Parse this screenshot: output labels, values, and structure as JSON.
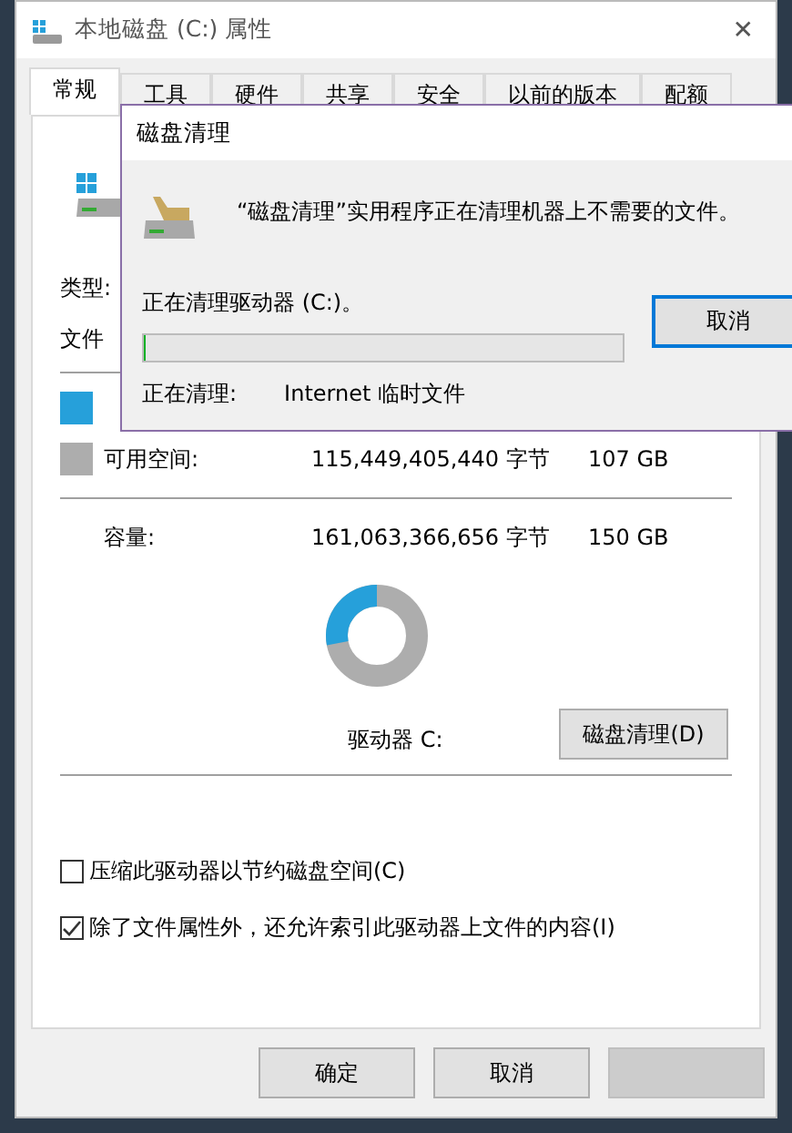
{
  "window": {
    "title": "本地磁盘 (C:) 属性",
    "close": "✕"
  },
  "tabs": [
    {
      "label": "常规",
      "selected": true
    },
    {
      "label": "工具",
      "selected": false
    },
    {
      "label": "硬件",
      "selected": false
    },
    {
      "label": "共享",
      "selected": false
    },
    {
      "label": "安全",
      "selected": false
    },
    {
      "label": "以前的版本",
      "selected": false
    },
    {
      "label": "配额",
      "selected": false
    }
  ],
  "general": {
    "type_label": "类型:",
    "fs_label": "文件",
    "space": [
      {
        "color": "#26a0da"
      },
      {
        "label": "可用空间:",
        "bytes": "115,449,405,440 字节",
        "size": "107 GB",
        "color": "#adadad"
      }
    ],
    "capacity": {
      "label": "容量:",
      "bytes": "161,063,366,656 字节",
      "size": "150 GB"
    },
    "usage": {
      "level": 0.28
    },
    "drive_label": "驱动器 C:",
    "cleanup_button": "磁盘清理(D)",
    "options": [
      {
        "label": "压缩此驱动器以节约磁盘空间(C)",
        "checked": false
      },
      {
        "label": "除了文件属性外，还允许索引此驱动器上文件的内容(I)",
        "checked": true
      }
    ]
  },
  "buttons": [
    {
      "label": "确定",
      "disabled": false
    },
    {
      "label": "取消",
      "disabled": false
    },
    {
      "disabled": true
    }
  ],
  "cleanup_dialog": {
    "title": "磁盘清理",
    "message": "“磁盘清理”实用程序正在清理机器上不需要的文件。",
    "status": "正在清理驱动器 (C:)。",
    "progress": {
      "level": 0
    },
    "current_label": "正在清理:",
    "current_item": "Internet 临时文件",
    "cancel": "取消"
  }
}
